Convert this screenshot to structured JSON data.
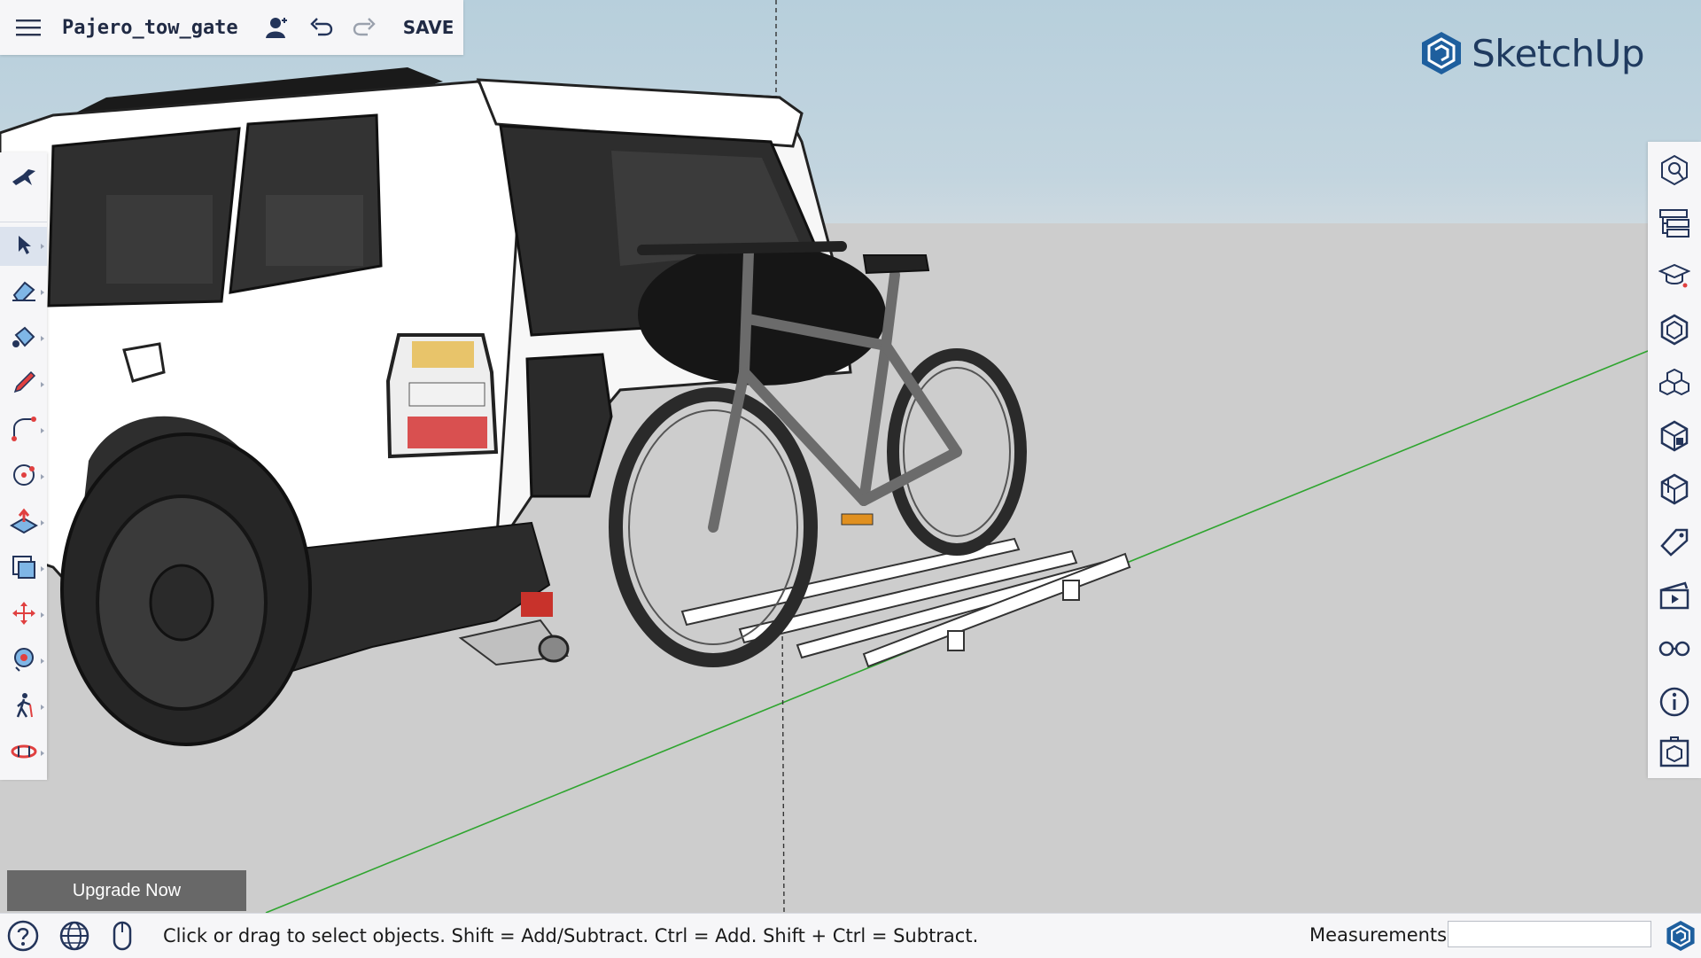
{
  "app": {
    "brand": "SketchUp",
    "accent": "#1f3a5f"
  },
  "header": {
    "document_title": "Pajero_tow_gate",
    "save_label": "SAVE",
    "icons": [
      "menu-icon",
      "add-collaborator-icon",
      "undo-icon",
      "redo-icon"
    ]
  },
  "left_tools": [
    "search-tool-icon",
    "select-tool-icon",
    "eraser-tool-icon",
    "paint-bucket-tool-icon",
    "pencil-line-tool-icon",
    "arc-tool-icon",
    "circle-tool-icon",
    "push-pull-tool-icon",
    "offset-tool-icon",
    "move-tool-icon",
    "orbit-tool-icon",
    "walk-tool-icon",
    "section-plane-tool-icon"
  ],
  "right_panels": [
    "entity-info-icon",
    "outliner-icon",
    "instructor-icon",
    "components-icon",
    "materials-icon",
    "styles-icon",
    "3d-warehouse-icon",
    "tags-icon",
    "scenes-icon",
    "display-icon",
    "info-icon",
    "model-info-icon"
  ],
  "upgrade_label": "Upgrade Now",
  "status": {
    "hint": "Click or drag to select objects. Shift = Add/Subtract. Ctrl = Add. Shift + Ctrl = Subtract.",
    "measurements_label": "Measurements",
    "measurements_value": ""
  }
}
